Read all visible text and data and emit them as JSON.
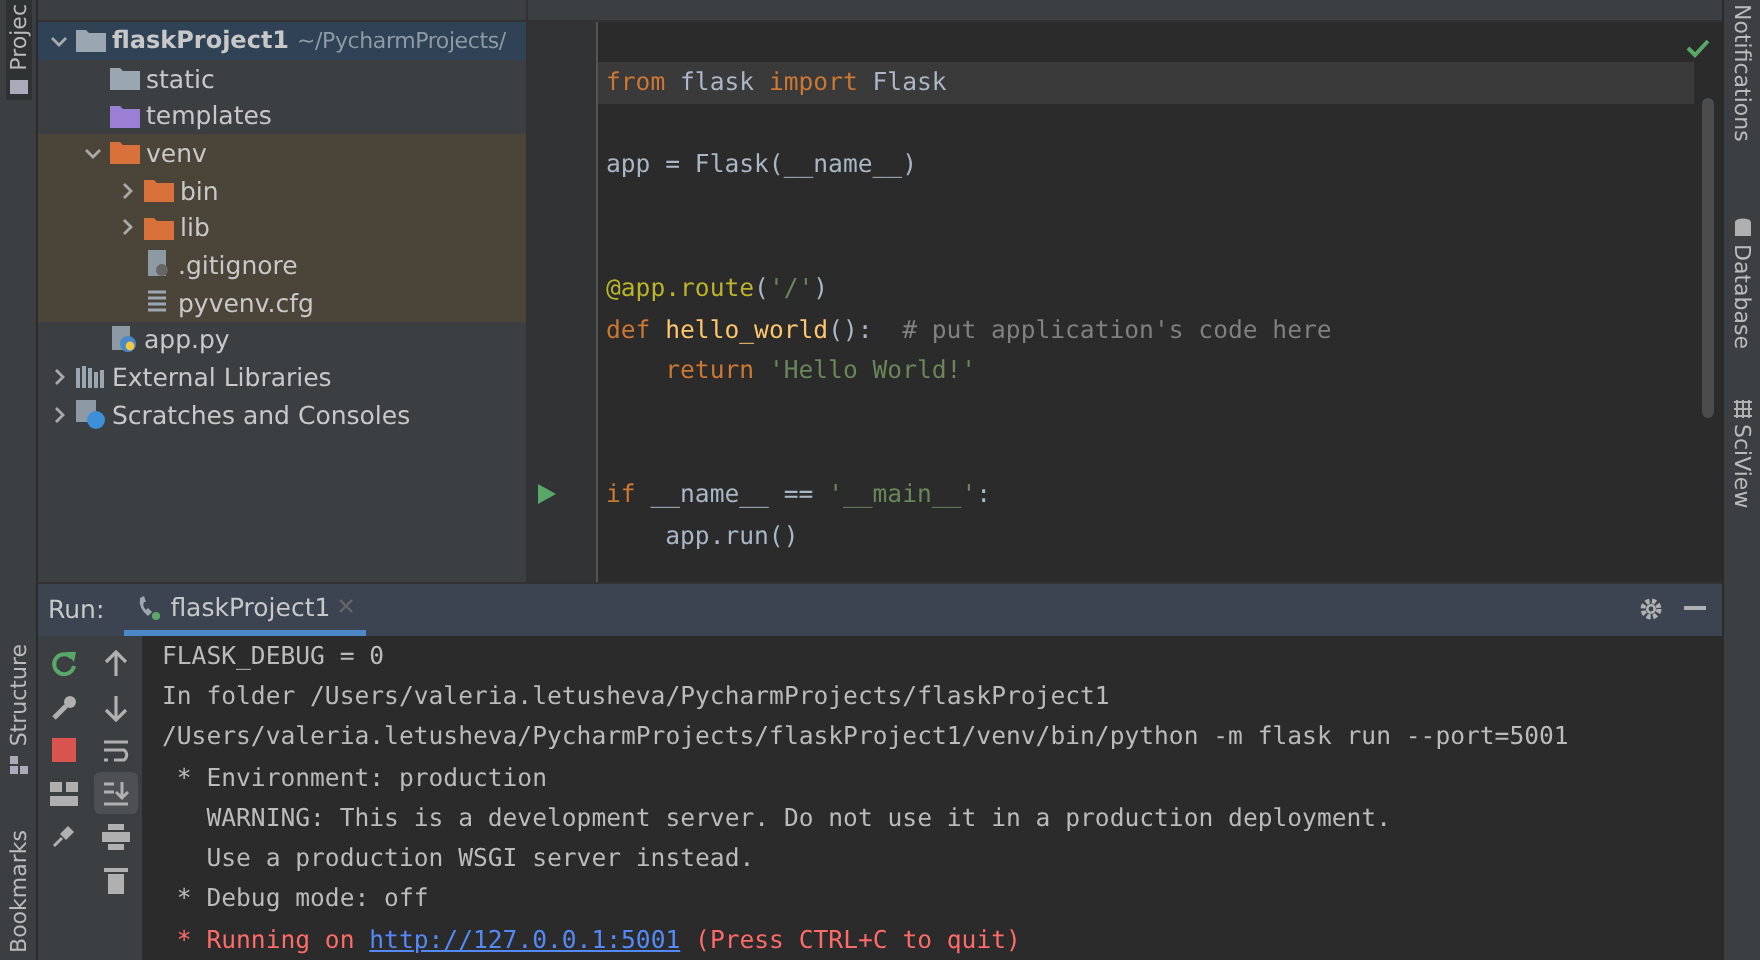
{
  "left_stripe": [
    {
      "label": "Projec",
      "kind": "project",
      "selected": true
    },
    {
      "label": "Structure",
      "kind": "structure",
      "selected": false
    },
    {
      "label": "Bookmarks",
      "kind": "bookmarks",
      "selected": false
    }
  ],
  "project_tree": [
    {
      "label": "flaskProject1",
      "hint": "~/PycharmProjects/",
      "kind": "folder",
      "selected": true,
      "expanded": true,
      "excluded": false,
      "children": [
        {
          "label": "static",
          "kind": "folder",
          "selected": false,
          "excluded": false
        },
        {
          "label": "templates",
          "kind": "folder-templates",
          "selected": false,
          "excluded": false
        },
        {
          "label": "venv",
          "kind": "folder-excluded",
          "selected": false,
          "expanded": true,
          "excluded": true,
          "children": [
            {
              "label": "bin",
              "kind": "folder-excluded",
              "selected": false,
              "expanded": false,
              "excluded": true
            },
            {
              "label": "lib",
              "kind": "folder-excluded",
              "selected": false,
              "expanded": false,
              "excluded": true
            },
            {
              "label": ".gitignore",
              "kind": "ignore-file",
              "selected": false,
              "excluded": true
            },
            {
              "label": "pyvenv.cfg",
              "kind": "text-file",
              "selected": false,
              "excluded": true
            }
          ]
        },
        {
          "label": "app.py",
          "kind": "python-file",
          "selected": false,
          "excluded": false
        }
      ]
    },
    {
      "label": "External Libraries",
      "kind": "libraries",
      "selected": false,
      "expanded": false,
      "excluded": false
    },
    {
      "label": "Scratches and Consoles",
      "kind": "scratches",
      "selected": false,
      "expanded": false,
      "excluded": false
    }
  ],
  "editor": {
    "lines": [
      {
        "current": true,
        "tokens": [
          {
            "text": "from",
            "kind": "keyword"
          },
          {
            "text": " flask ",
            "kind": "plain"
          },
          {
            "text": "import",
            "kind": "keyword"
          },
          {
            "text": " Flask",
            "kind": "plain"
          }
        ]
      },
      {
        "current": false
      },
      {
        "current": false,
        "tokens": [
          {
            "text": "app = Flask(__name__)",
            "kind": "plain"
          }
        ]
      },
      {
        "current": false
      },
      {
        "current": false
      },
      {
        "current": false,
        "tokens": [
          {
            "text": "@app.route",
            "kind": "decorator"
          },
          {
            "text": "(",
            "kind": "plain"
          },
          {
            "text": "'/'",
            "kind": "string"
          },
          {
            "text": ")",
            "kind": "plain"
          }
        ]
      },
      {
        "current": false,
        "tokens": [
          {
            "text": "def ",
            "kind": "keyword"
          },
          {
            "text": "hello_world",
            "kind": "function"
          },
          {
            "text": "():  ",
            "kind": "plain"
          },
          {
            "text": "# put application's code here",
            "kind": "comment"
          }
        ]
      },
      {
        "current": false,
        "tokens": [
          {
            "text": "    return ",
            "kind": "keyword"
          },
          {
            "text": "'Hello World!'",
            "kind": "string"
          }
        ]
      },
      {
        "current": false
      },
      {
        "current": false
      },
      {
        "current": false,
        "run_marker": true,
        "tokens": [
          {
            "text": "if",
            "kind": "keyword"
          },
          {
            "text": " __name__ == ",
            "kind": "plain"
          },
          {
            "text": "'__main__'",
            "kind": "string"
          },
          {
            "text": ":",
            "kind": "plain"
          }
        ]
      },
      {
        "current": false,
        "tokens": [
          {
            "text": "    app.run()",
            "kind": "plain"
          }
        ]
      }
    ]
  },
  "right_stripe": [
    {
      "label": "Notifications",
      "kind": "bell"
    },
    {
      "label": "Database",
      "kind": "database"
    },
    {
      "label": "SciView",
      "kind": "sciview"
    }
  ],
  "run_panel": {
    "label": "Run:",
    "tab": {
      "label": "flaskProject1",
      "selected": true
    },
    "toolbar_left": [
      {
        "kind": "rerun",
        "on": false
      },
      {
        "kind": "wrench",
        "on": false
      },
      {
        "kind": "stop",
        "on": false
      },
      {
        "kind": "layout",
        "on": false
      },
      {
        "kind": "pin",
        "on": false
      }
    ],
    "toolbar_right": [
      {
        "kind": "up",
        "on": false
      },
      {
        "kind": "down",
        "on": false
      },
      {
        "kind": "wrap",
        "on": false
      },
      {
        "kind": "scroll-end",
        "on": true
      },
      {
        "kind": "print",
        "on": false
      },
      {
        "kind": "trash",
        "on": false
      }
    ],
    "console": [
      {
        "kind": "output",
        "segments": [
          {
            "text": "FLASK_DEBUG = 0",
            "kind": "text"
          }
        ]
      },
      {
        "kind": "output",
        "segments": [
          {
            "text": "In folder /Users/valeria.letusheva/PycharmProjects/flaskProject1",
            "kind": "text"
          }
        ]
      },
      {
        "kind": "output",
        "segments": [
          {
            "text": "/Users/valeria.letusheva/PycharmProjects/flaskProject1/venv/bin/python -m flask run --port=5001",
            "kind": "text"
          }
        ]
      },
      {
        "kind": "output",
        "segments": [
          {
            "text": " * Environment: production",
            "kind": "text"
          }
        ]
      },
      {
        "kind": "output",
        "segments": [
          {
            "text": "   WARNING: This is a development server. Do not use it in a production deployment.",
            "kind": "text"
          }
        ]
      },
      {
        "kind": "output",
        "segments": [
          {
            "text": "   Use a production WSGI server instead.",
            "kind": "text"
          }
        ]
      },
      {
        "kind": "output",
        "segments": [
          {
            "text": " * Debug mode: off",
            "kind": "text"
          }
        ]
      },
      {
        "kind": "error",
        "segments": [
          {
            "text": " * Running on ",
            "kind": "text"
          },
          {
            "text": "http://127.0.0.1:5001",
            "kind": "link"
          },
          {
            "text": " (Press CTRL+C to quit)",
            "kind": "text"
          }
        ]
      }
    ]
  }
}
